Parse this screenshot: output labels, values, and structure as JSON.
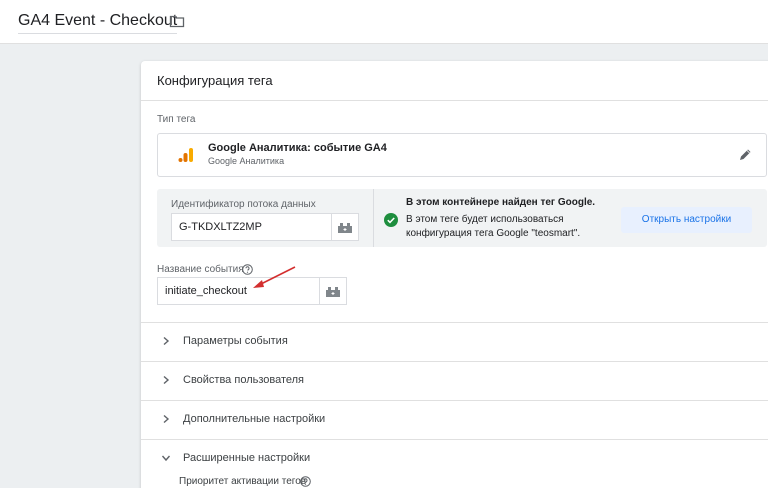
{
  "header": {
    "title": "GA4 Event - Checkout",
    "folder_icon": "folder-icon"
  },
  "card": {
    "title": "Конфигурация тега",
    "tag_type_label": "Тип тега",
    "tag_type": {
      "name": "Google Аналитика: событие GA4",
      "subtitle": "Google Аналитика",
      "icon": "google-analytics-icon",
      "icon_colors": [
        "#f9ab00",
        "#e37400"
      ]
    },
    "stream": {
      "label": "Идентификатор потока данных",
      "value": "G-TKDXLTZ2MP",
      "found_title": "В этом контейнере найден тег Google.",
      "found_line1": "В этом теге будет использоваться",
      "found_line2": "конфигурация тега Google \"teosmart\".",
      "button_label": "Открыть настройки"
    },
    "event_name": {
      "label": "Название события",
      "value": "initiate_checkout"
    },
    "sections": [
      {
        "label": "Параметры события",
        "expanded": false
      },
      {
        "label": "Свойства пользователя",
        "expanded": false
      },
      {
        "label": "Дополнительные настройки",
        "expanded": false
      },
      {
        "label": "Расширенные настройки",
        "expanded": true
      }
    ],
    "priority_label": "Приоритет активации тегов"
  },
  "colors": {
    "accent": "#1a73e8",
    "accent_bg": "#e8f0fe",
    "success": "#1e8e3e",
    "annotation_arrow": "#d32f2f"
  }
}
